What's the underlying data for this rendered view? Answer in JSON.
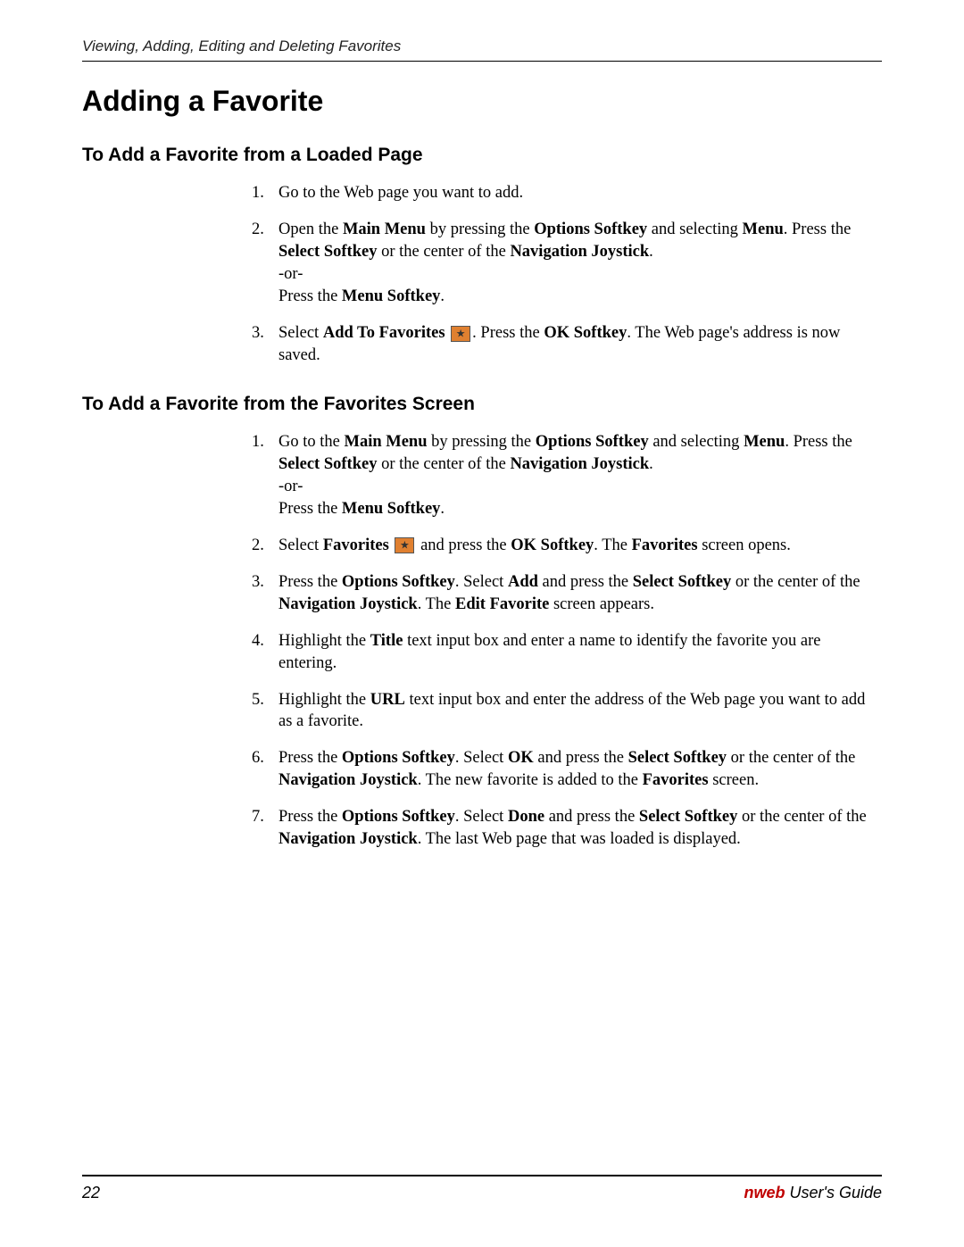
{
  "header": {
    "sectionTitle": "Viewing, Adding, Editing and Deleting Favorites"
  },
  "title": "Adding a Favorite",
  "sections": [
    {
      "heading": "To Add a Favorite from a Loaded Page",
      "steps": [
        {
          "html": "Go to the Web page you want to add."
        },
        {
          "html": "Open the <span class=\"b\">Main Menu</span> by pressing the <span class=\"b\">Options Softkey</span> and selecting <span class=\"b\">Menu</span>. Press the <span class=\"b\">Select Softkey</span> or the center of the <span class=\"b\">Navigation Joystick</span>.<br>-or-<br>Press the <span class=\"b\">Menu Softkey</span>."
        },
        {
          "html": "Select <span class=\"b\">Add To Favorites</span> <span class=\"icon-inline\" data-name=\"favorites-star-icon\" data-interactable=\"false\"></span>. Press the <span class=\"b\">OK Softkey</span>. The Web page's address is now saved."
        }
      ]
    },
    {
      "heading": "To Add a Favorite from the Favorites Screen",
      "steps": [
        {
          "html": "Go to the <span class=\"b\">Main Menu</span> by pressing the <span class=\"b\">Options Softkey</span> and selecting <span class=\"b\">Menu</span>. Press the <span class=\"b\">Select Softkey</span> or the center of the <span class=\"b\">Navigation Joystick</span>.<br>-or-<br>Press the <span class=\"b\">Menu Softkey</span>."
        },
        {
          "html": "Select <span class=\"b\">Favorites</span> <span class=\"icon-inline\" data-name=\"favorites-star-icon\" data-interactable=\"false\"></span> and press the <span class=\"b\">OK Softkey</span>. The <span class=\"b\">Favorites</span> screen opens."
        },
        {
          "html": "Press the <span class=\"b\">Options Softkey</span>. Select <span class=\"b\">Add</span> and press the <span class=\"b\">Select Softkey</span> or the center of the <span class=\"b\">Navigation Joystick</span>. The <span class=\"b\">Edit Favorite</span> screen appears."
        },
        {
          "html": "Highlight the <span class=\"b\">Title</span> text input box and enter a name to identify the favorite you are entering."
        },
        {
          "html": "Highlight the <span class=\"b\">URL</span> text input box and enter the address of the Web page you want to add as a favorite."
        },
        {
          "html": "Press the <span class=\"b\">Options Softkey</span>. Select <span class=\"b\">OK</span> and press the <span class=\"b\">Select Softkey</span> or the center of the <span class=\"b\">Navigation Joystick</span>. The new favorite is added to the <span class=\"b\">Favorites</span> screen."
        },
        {
          "html": "Press the <span class=\"b\">Options Softkey</span>. Select <span class=\"b\">Done</span> and press the <span class=\"b\">Select Softkey</span> or the center of the <span class=\"b\">Navigation Joystick</span>. The last Web page that was loaded is displayed."
        }
      ]
    }
  ],
  "footer": {
    "pageNumber": "22",
    "brand": "nweb",
    "guideLabel": " User's Guide"
  }
}
